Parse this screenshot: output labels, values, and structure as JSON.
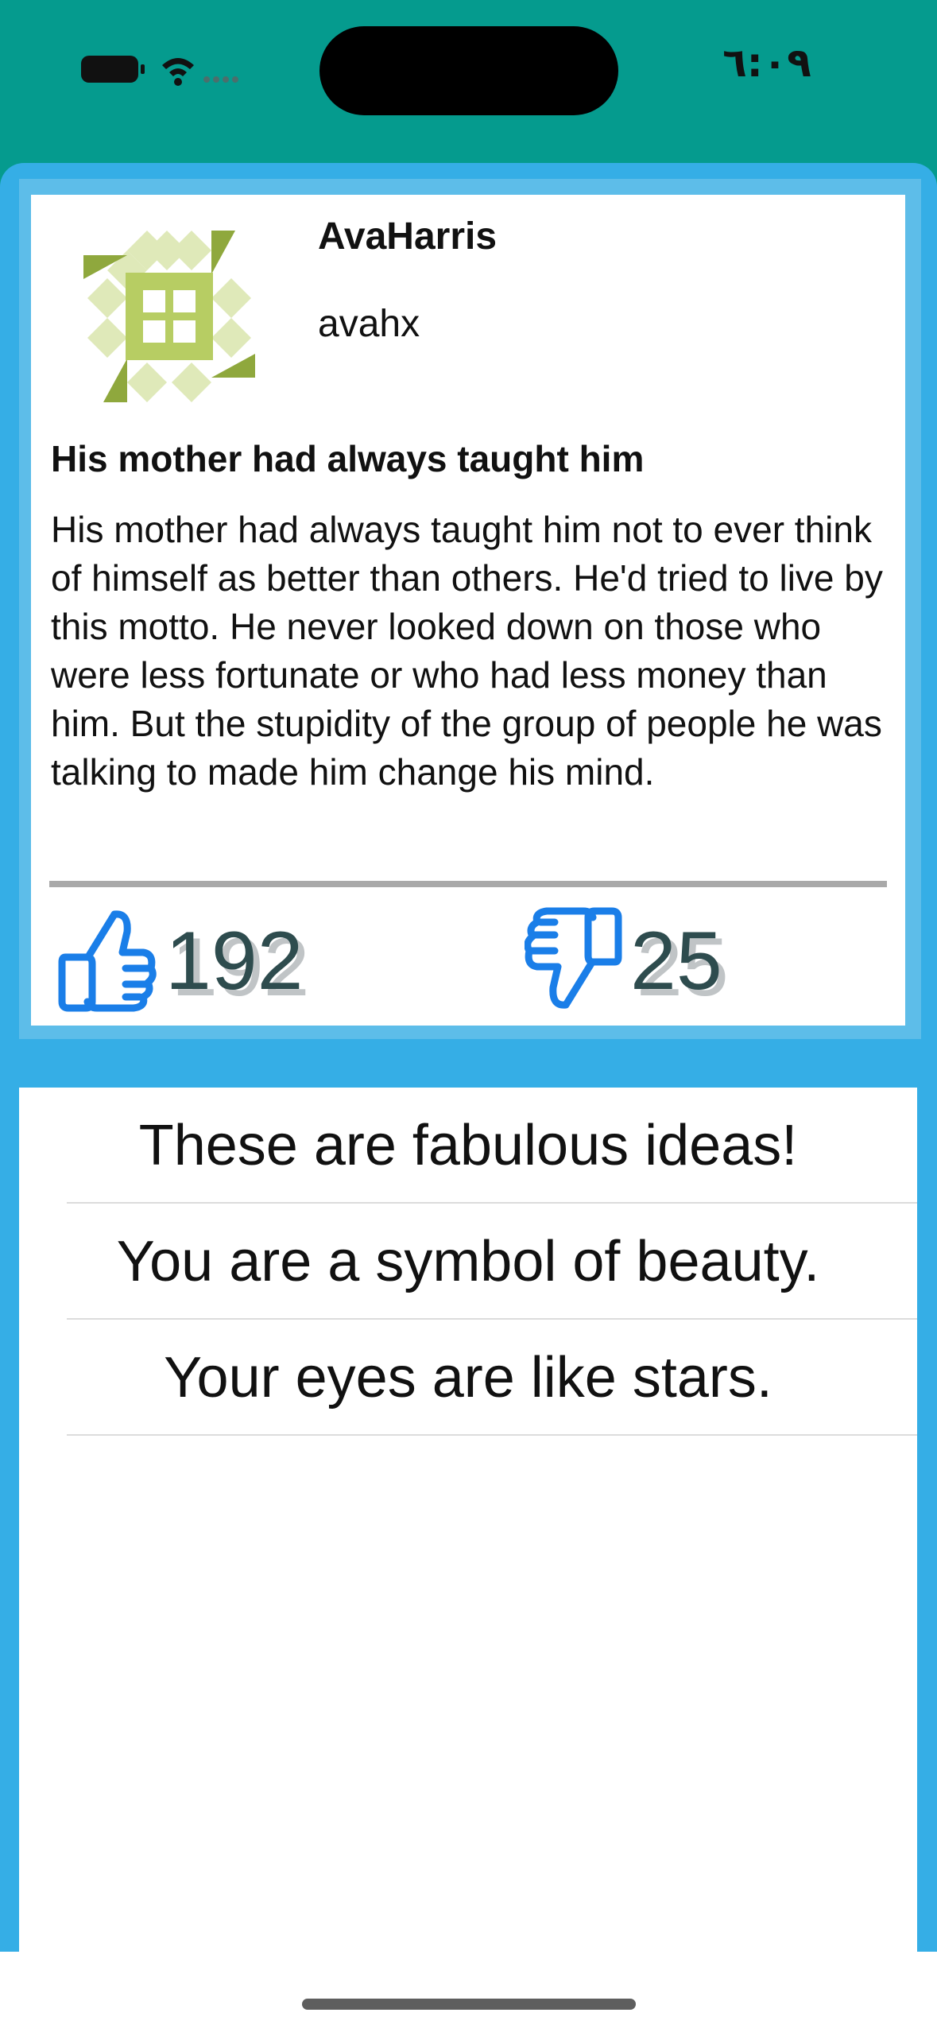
{
  "status_bar": {
    "time": "٦:٠٩",
    "icons": [
      "battery-icon",
      "wifi-icon",
      "cellular-signal-icon"
    ]
  },
  "post": {
    "display_name": "AvaHarris",
    "username": "avahx",
    "title": "His mother had always taught him",
    "body": "His mother had always taught him not to ever think of himself as better than others. He'd tried to live by this motto. He never looked down on those who were less fortunate or who had less money than him. But the stupidity of the group of people he was talking to made him change his mind.",
    "likes": "192",
    "dislikes": "25"
  },
  "comments": [
    {
      "text": "These are fabulous ideas!"
    },
    {
      "text": "You are a symbol of beauty."
    },
    {
      "text": "Your eyes are like stars."
    }
  ],
  "colors": {
    "status_bar_bg": "#059b8e",
    "app_bg": "#35aee6",
    "icon_blue": "#1a7ee8",
    "count_text": "#2e4c4e"
  }
}
